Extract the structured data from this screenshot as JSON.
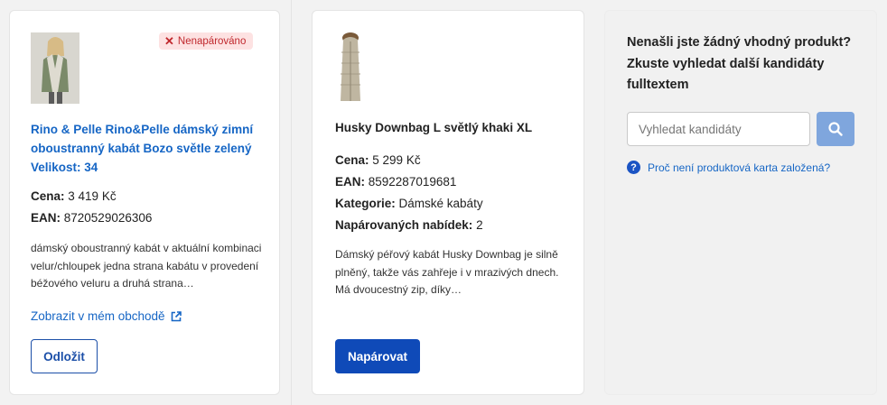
{
  "candidate": {
    "badge": "Nenapárováno",
    "title": "Rino & Pelle Rino&Pelle dámský zimní oboustranný kabát Bozo světle zelený Velikost: 34",
    "price_label": "Cena:",
    "price_value": "3 419 Kč",
    "ean_label": "EAN:",
    "ean_value": "8720529026306",
    "description": "dámský oboustranný kabát v aktuální kombinaci velur/chloupek jedna strana kabátu v provedení béžového veluru a druhá strana…",
    "shop_link": "Zobrazit v mém obchodě",
    "postpone_button": "Odložit"
  },
  "match": {
    "title": "Husky Downbag L světlý khaki XL",
    "price_label": "Cena:",
    "price_value": "5 299 Kč",
    "ean_label": "EAN:",
    "ean_value": "8592287019681",
    "category_label": "Kategorie:",
    "category_value": "Dámské kabáty",
    "offers_label": "Napárovaných nabídek:",
    "offers_value": "2",
    "description": "Dámský péřový kabát Husky Downbag je silně plněný, takže vás zahřeje i v mrazivých dnech. Má dvoucestný zip, díky…",
    "pair_button": "Napárovat"
  },
  "search": {
    "heading": "Nenašli jste žádný vhodný produkt? Zkuste vyhledat další kandidáty fulltextem",
    "placeholder": "Vyhledat kandidáty",
    "help_link": "Proč není produktová karta založená?"
  },
  "colors": {
    "accent": "#0f4ab8",
    "link": "#1666c5",
    "badge_bg": "#fde2e2",
    "badge_text": "#c0282d"
  },
  "icons": [
    "x-icon",
    "external-link-icon",
    "search-icon",
    "question-circle-icon"
  ]
}
